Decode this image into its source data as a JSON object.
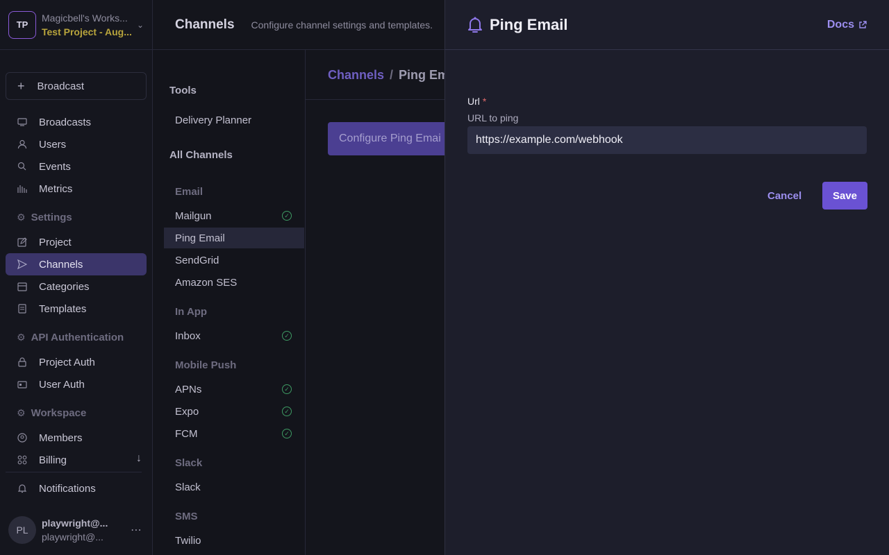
{
  "workspace": {
    "avatar": "TP",
    "name": "Magicbell's Works...",
    "project": "Test Project - Aug..."
  },
  "sidebar": {
    "broadcast_button": "Broadcast",
    "items": {
      "broadcasts": "Broadcasts",
      "users": "Users",
      "events": "Events",
      "metrics": "Metrics",
      "settings": "Settings",
      "project": "Project",
      "channels": "Channels",
      "categories": "Categories",
      "templates": "Templates",
      "api_authentication": "API Authentication",
      "project_auth": "Project Auth",
      "user_auth": "User Auth",
      "workspace": "Workspace",
      "members": "Members",
      "billing": "Billing",
      "notifications": "Notifications"
    },
    "user": {
      "avatar": "PL",
      "name": "playwright@...",
      "email": "playwright@..."
    }
  },
  "header": {
    "title": "Channels",
    "subtitle": "Configure channel settings and templates."
  },
  "channels_list": {
    "tools_heading": "Tools",
    "delivery_planner": "Delivery Planner",
    "all_channels_heading": "All Channels",
    "groups": {
      "email": "Email",
      "in_app": "In App",
      "mobile_push": "Mobile Push",
      "slack": "Slack",
      "sms": "SMS"
    },
    "items": {
      "mailgun": "Mailgun",
      "ping_email": "Ping Email",
      "sendgrid": "SendGrid",
      "amazon_ses": "Amazon SES",
      "inbox": "Inbox",
      "apns": "APNs",
      "expo": "Expo",
      "fcm": "FCM",
      "slack": "Slack",
      "twilio": "Twilio"
    }
  },
  "detail": {
    "breadcrumb_root": "Channels",
    "breadcrumb_sep": "/",
    "breadcrumb_current": "Ping Em",
    "configure_button": "Configure Ping Emai"
  },
  "panel": {
    "title": "Ping Email",
    "docs_link": "Docs",
    "field_label": "Url",
    "required_mark": "*",
    "field_help": "URL to ping",
    "url_value": "https://example.com/webhook",
    "cancel_label": "Cancel",
    "save_label": "Save"
  },
  "colors": {
    "accent": "#6a52d3",
    "link": "#9d8ff0",
    "success": "#3e9a63",
    "project_name": "#b8a43c"
  }
}
